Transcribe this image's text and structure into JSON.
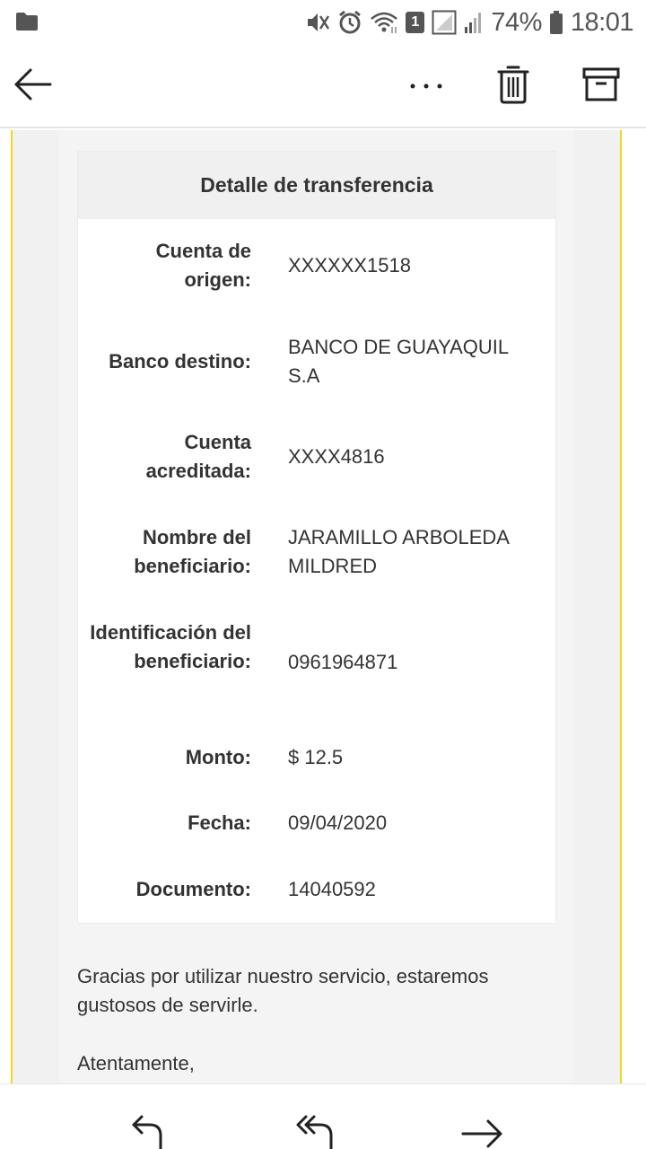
{
  "status_bar": {
    "battery": "74%",
    "time": "18:01",
    "sim_slot": "1",
    "icons": [
      "folder-icon",
      "mute-vibrate-icon",
      "alarm-icon",
      "wifi-icon",
      "sim-badge-icon",
      "signal-empty-icon",
      "signal-icon",
      "battery-icon"
    ]
  },
  "toolbar": {
    "icons": [
      "back-arrow-icon",
      "more-dots-icon",
      "trash-icon",
      "archive-icon"
    ]
  },
  "email": {
    "table_title": "Detalle de transferencia",
    "rows": [
      {
        "label": "Cuenta de origen:",
        "value": "XXXXXX1518"
      },
      {
        "label": "Banco destino:",
        "value": "BANCO DE GUAYAQUIL S.A"
      },
      {
        "label": "Cuenta acreditada:",
        "value": "XXXX4816"
      },
      {
        "label": "Nombre del beneficiario:",
        "value": "JARAMILLO ARBOLEDA MILDRED"
      },
      {
        "label": "Identificación del beneficiario:",
        "value": "0961964871"
      },
      {
        "label": "Monto:",
        "value": "$ 12.5"
      },
      {
        "label": "Fecha:",
        "value": "09/04/2020"
      },
      {
        "label": "Documento:",
        "value": "14040592"
      }
    ],
    "thanks_text": "Gracias por utilizar nuestro servicio, estaremos gustosos de servirle.",
    "regards_text": "Atentamente,"
  },
  "bottom_bar": {
    "icons": [
      "reply-icon",
      "reply-all-icon",
      "forward-icon"
    ]
  },
  "colors": {
    "accent_yellow": "#f0d81a",
    "text": "#333333",
    "icon_gray": "#555555"
  }
}
